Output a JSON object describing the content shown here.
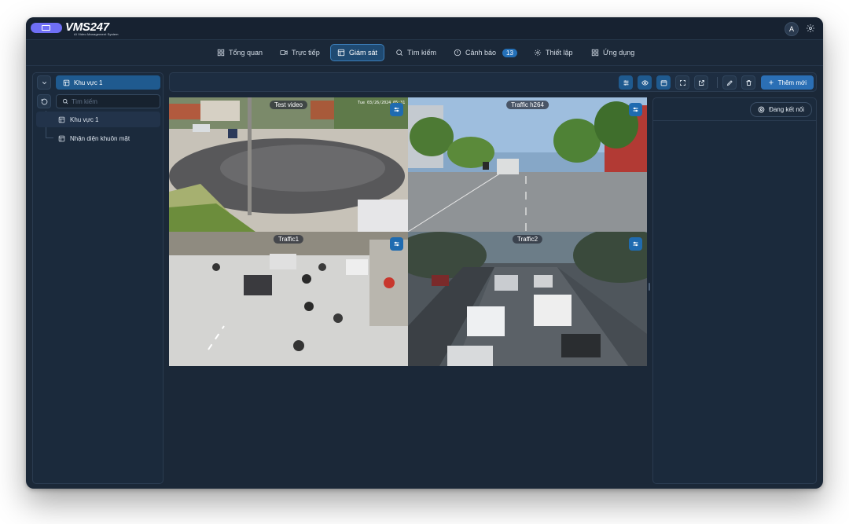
{
  "app": {
    "logo_text": "VMS247",
    "logo_subtitle": "AI Video Management System",
    "avatar_initial": "A"
  },
  "nav": {
    "items": [
      {
        "label": "Tổng quan",
        "icon": "grid-icon"
      },
      {
        "label": "Trực tiếp",
        "icon": "video-camera-icon"
      },
      {
        "label": "Giám sát",
        "icon": "layout-icon",
        "active": true
      },
      {
        "label": "Tìm kiếm",
        "icon": "search-icon"
      },
      {
        "label": "Cảnh báo",
        "icon": "alert-icon",
        "badge": "13"
      },
      {
        "label": "Thiết lập",
        "icon": "gear-icon"
      },
      {
        "label": "Ứng dụng",
        "icon": "apps-icon"
      }
    ]
  },
  "left_panel": {
    "area_select": "Khu vực 1",
    "search_placeholder": "Tìm kiếm",
    "tree": [
      {
        "label": "Khu vực 1"
      },
      {
        "label": "Nhận diện khuôn mặt"
      }
    ]
  },
  "toolbar": {
    "add_label": "Thêm mới"
  },
  "cameras": [
    {
      "caption": "Test video",
      "timestamp": "Tue 03/26/2024 05:31"
    },
    {
      "caption": "Traffic h264"
    },
    {
      "caption": "Traffic1"
    },
    {
      "caption": "Traffic2"
    }
  ],
  "right_panel": {
    "connect_label": "Đang kết nối"
  },
  "colors": {
    "accent": "#2b6fb5",
    "active_nav": "#1f4a72",
    "background": "#1b2838",
    "logo_pill": "#6f6ff5"
  }
}
